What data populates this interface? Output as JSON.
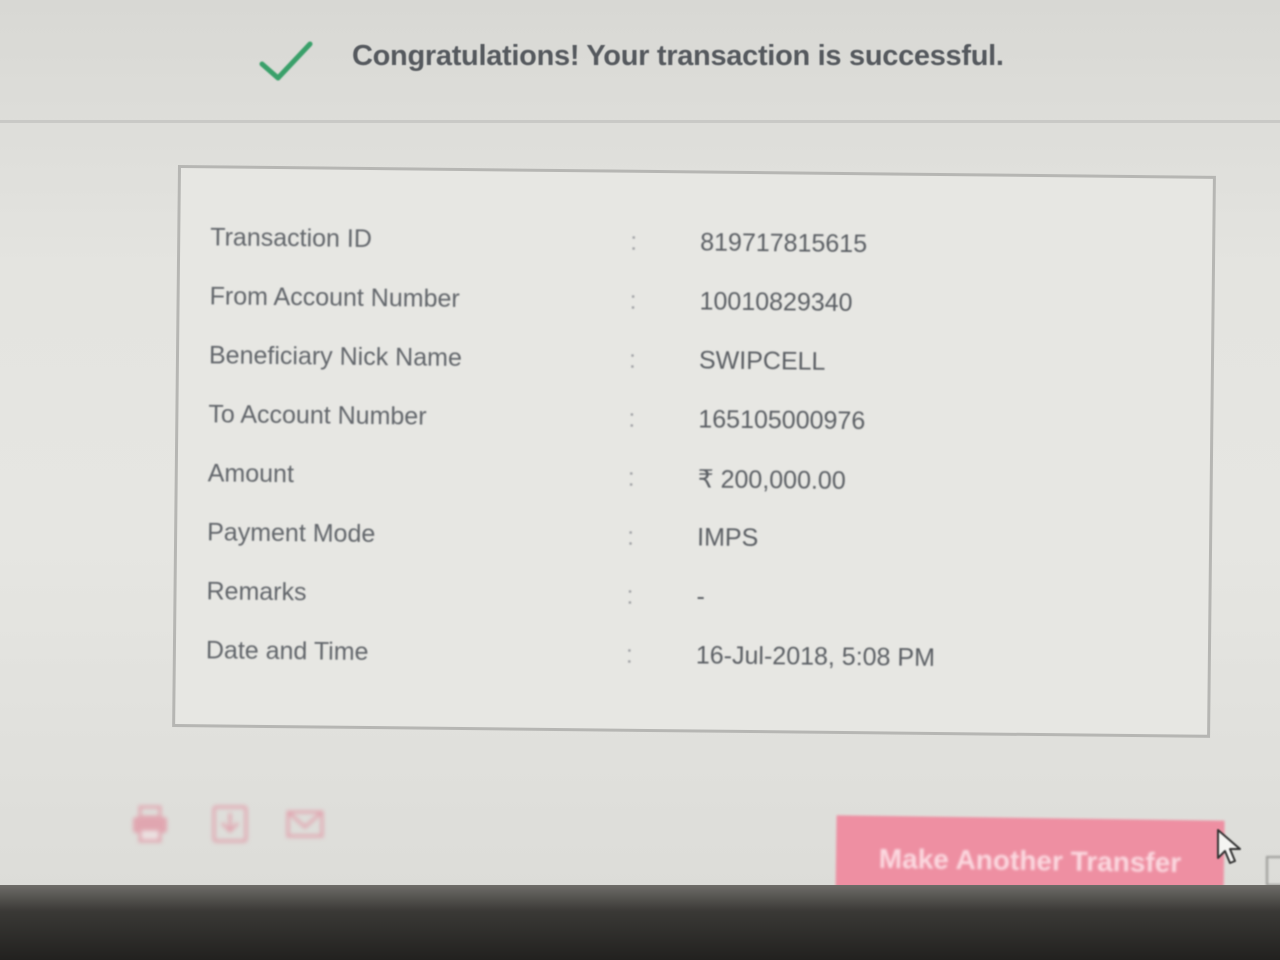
{
  "success": {
    "message": "Congratulations! Your transaction is successful.",
    "icon": "check-icon",
    "color": "#3aa06a"
  },
  "details": [
    {
      "label": "Transaction ID",
      "separator": ":",
      "value": "819717815615"
    },
    {
      "label": "From Account Number",
      "separator": ":",
      "value": "10010829340"
    },
    {
      "label": "Beneficiary Nick Name",
      "separator": ":",
      "value": "SWIPCELL"
    },
    {
      "label": "To Account Number",
      "separator": ":",
      "value": "165105000976"
    },
    {
      "label": "Amount",
      "separator": ":",
      "value": "₹ 200,000.00"
    },
    {
      "label": "Payment Mode",
      "separator": ":",
      "value": "IMPS"
    },
    {
      "label": "Remarks",
      "separator": ":",
      "value": "-"
    },
    {
      "label": "Date and Time",
      "separator": ":",
      "value": "16-Jul-2018, 5:08 PM"
    }
  ],
  "actions": {
    "icons": [
      "print-icon",
      "download-icon",
      "mail-icon"
    ],
    "transfer_button_label": "Make Another Transfer",
    "accent_color": "#ee8fa2"
  }
}
